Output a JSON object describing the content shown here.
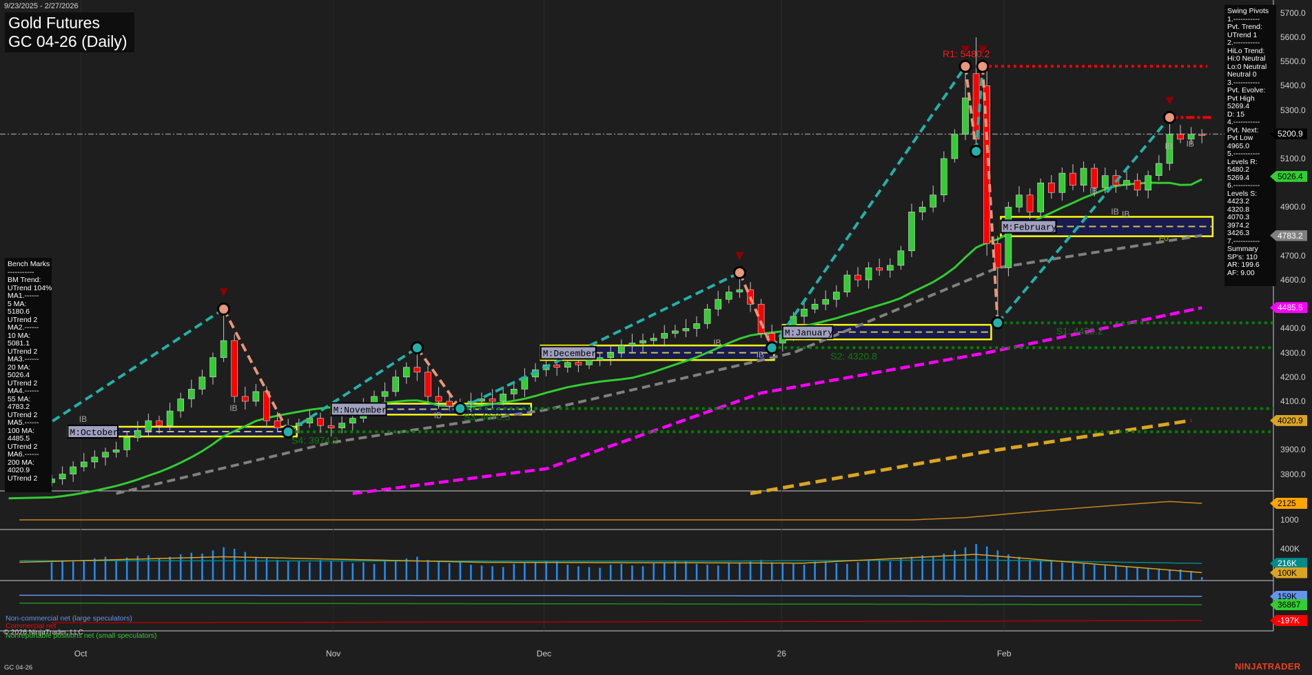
{
  "header": {
    "date_range": "9/23/2025 - 2/27/2026",
    "title_line1": "Gold Futures",
    "title_line2": "GC 04-26 (Daily)"
  },
  "bench_marks": [
    "Bench Marks",
    "-----------",
    "BM Trend:",
    "UTrend 104%",
    "MA1.------",
    "5 MA:",
    "5180.6",
    "UTrend 2",
    "MA2.------",
    "10 MA:",
    "5081.1",
    "UTrend 2",
    "MA3.------",
    "20 MA:",
    "5026.4",
    "UTrend 2",
    "MA4.------",
    "55 MA:",
    "4783.2",
    "UTrend 2",
    "MA5.------",
    "100 MA:",
    "4485.5",
    "UTrend 2",
    "MA6.------",
    "200 MA:",
    "4020.9",
    "UTrend 2"
  ],
  "swing_pivots": [
    "Swing Pivots",
    "1.-----------",
    "Pvt. Trend:",
    "UTrend 1",
    "2.-----------",
    "HiLo Trend:",
    "Hi:0 Neutral",
    "Lo:0 Neutral",
    "Neutral 0",
    "3.-----------",
    "Pvt. Evolve:",
    "Pvt High",
    "5269.4",
    "D: 15",
    "4.-----------",
    "Pvt. Next:",
    "Pvt Low",
    "4965.0",
    "5.-----------",
    "Levels R:",
    "5480.2",
    "5269.4",
    "6.-----------",
    "Levels S:",
    "4423.2",
    "4320.8",
    "4070.3",
    "3974.2",
    "3426.3",
    "7.-----------",
    "Summary",
    "SP's: 110",
    "AR: 199.6",
    "AF: 9.00"
  ],
  "price_axis": [
    "5700.0",
    "5600.0",
    "5500.0",
    "5400.0",
    "5300.0",
    "5100.0",
    "4900.0",
    "4700.0",
    "4600.0",
    "4400.0",
    "4300.0",
    "4200.0",
    "4100.0",
    "3900.0",
    "3800.0"
  ],
  "price_axis_values": [
    5700,
    5600,
    5500,
    5400,
    5300,
    5100,
    4900,
    4700,
    4600,
    4400,
    4300,
    4200,
    4100,
    3900,
    3800
  ],
  "tags": [
    {
      "label": "5200.9",
      "value": 5200.9,
      "panel": "price",
      "bg": "#000000",
      "fg": "#ffffff"
    },
    {
      "label": "5026.4",
      "value": 5026.4,
      "panel": "price",
      "bg": "#32cd32",
      "fg": "#000000"
    },
    {
      "label": "4783.2",
      "value": 4783.2,
      "panel": "price",
      "bg": "#808080",
      "fg": "#ffffff"
    },
    {
      "label": "4485.5",
      "value": 4485.5,
      "panel": "price",
      "bg": "#ff00ff",
      "fg": "#ffffff"
    },
    {
      "label": "4020.9",
      "value": 4020.9,
      "panel": "price",
      "bg": "#daa520",
      "fg": "#000000"
    },
    {
      "label": "2125",
      "value": 2125,
      "panel": "p2",
      "bg": "#ffa500",
      "fg": "#000000"
    },
    {
      "label": "216K",
      "value": 216,
      "panel": "vol",
      "bg": "#008b8b",
      "fg": "#ffffff"
    },
    {
      "label": "100K",
      "value": 100,
      "panel": "vol",
      "bg": "#daa520",
      "fg": "#000000"
    },
    {
      "label": "159K",
      "value": 159,
      "panel": "cot",
      "bg": "#6495ed",
      "fg": "#000000"
    },
    {
      "label": "36867",
      "value": 36.867,
      "panel": "cot",
      "bg": "#32cd32",
      "fg": "#000000"
    },
    {
      "label": "-197K",
      "value": -197,
      "panel": "cot",
      "bg": "#ff0000",
      "fg": "#ffffff"
    }
  ],
  "sub_axis": {
    "p2_tick": "1000",
    "p2_tick_value": 1000,
    "vol_tick": "400K",
    "vol_tick_value": 400
  },
  "x_axis": [
    {
      "label": "Oct",
      "index": 2.7
    },
    {
      "label": "Nov",
      "index": 26.2
    },
    {
      "label": "Dec",
      "index": 45.8
    },
    {
      "label": "26",
      "index": 67.9
    },
    {
      "label": "Feb",
      "index": 88.6
    }
  ],
  "legend": {
    "noncommercial": "Non-commercial net (large speculators)",
    "commercial": "Commercial net",
    "nonreportable": "Nonreportable positions net (small speculators)",
    "copyright": "© 2026 NinjaTrader, LLC"
  },
  "footer": {
    "instrument": "GC 04-26",
    "brand": "NINJATRADER"
  },
  "colors": {
    "up": "#32cd32",
    "down": "#ff0000",
    "ma20": "#32cd32",
    "ma55": "#808080",
    "ma100": "#ff00ff",
    "ma200": "#daa520",
    "swing_up": "#20b2aa",
    "swing_down": "#e9967a",
    "support": "#008000",
    "resistance": "#ff0000",
    "box_fill": "#191a4f",
    "box_border": "#ffff00"
  },
  "chart_data": {
    "type": "candlestick",
    "title": "Gold Futures GC 04-26 (Daily)",
    "ylim": [
      3750,
      5720
    ],
    "closes": [
      3780,
      3800,
      3830,
      3850,
      3870,
      3890,
      3900,
      3950,
      3980,
      4020,
      4000,
      4060,
      4110,
      4150,
      4200,
      4280,
      4350,
      4120,
      4100,
      4140,
      4020,
      3990,
      4000,
      4010,
      4030,
      4000,
      3990,
      4010,
      4030,
      4080,
      4120,
      4140,
      4200,
      4240,
      4220,
      4120,
      4100,
      4080,
      4090,
      4100,
      4110,
      4100,
      4130,
      4150,
      4200,
      4230,
      4250,
      4240,
      4260,
      4250,
      4270,
      4280,
      4300,
      4330,
      4340,
      4350,
      4360,
      4380,
      4390,
      4400,
      4420,
      4480,
      4520,
      4550,
      4560,
      4500,
      4380,
      4340,
      4370,
      4450,
      4480,
      4500,
      4520,
      4550,
      4620,
      4600,
      4650,
      4640,
      4660,
      4720,
      4880,
      4900,
      4950,
      5100,
      5200,
      5350,
      5180,
      4750,
      4650,
      4900,
      4950,
      4880,
      5000,
      4960,
      5040,
      4990,
      5060,
      4980,
      5030,
      4990,
      5010,
      4970,
      5030,
      5080,
      5200,
      5180,
      5200,
      5195
    ],
    "overrides": {
      "16": {
        "h": 4480
      },
      "22": {
        "l": 3974
      },
      "34": {
        "h": 4320
      },
      "38": {
        "l": 4070
      },
      "64": {
        "h": 4630
      },
      "67": {
        "l": 4320
      },
      "85": {
        "h": 5480,
        "o": 5200
      },
      "86": {
        "o": 5450,
        "h": 5600,
        "l": 5130
      },
      "87": {
        "o": 5400,
        "h": 5480,
        "l": 4700
      },
      "88": {
        "l": 4423
      },
      "104": {
        "h": 5269
      }
    },
    "volume_k": [
      230,
      250,
      240,
      260,
      280,
      300,
      270,
      290,
      310,
      320,
      280,
      300,
      330,
      350,
      340,
      380,
      420,
      400,
      360,
      300,
      280,
      260,
      250,
      240,
      230,
      260,
      250,
      240,
      220,
      230,
      210,
      250,
      260,
      280,
      300,
      260,
      240,
      220,
      230,
      200,
      190,
      180,
      170,
      210,
      220,
      230,
      240,
      250,
      200,
      180,
      170,
      160,
      200,
      210,
      190,
      180,
      220,
      230,
      240,
      250,
      210,
      200,
      190,
      220,
      230,
      240,
      260,
      230,
      220,
      210,
      200,
      240,
      230,
      220,
      210,
      230,
      250,
      260,
      240,
      280,
      300,
      320,
      300,
      340,
      380,
      420,
      460,
      430,
      380,
      330,
      300,
      260,
      250,
      240,
      230,
      220,
      210,
      200,
      190,
      180,
      170,
      160,
      160,
      150,
      140,
      140,
      120,
      44
    ],
    "ma55": [
      [
        6,
        3720
      ],
      [
        26,
        3930
      ],
      [
        46,
        4065
      ],
      [
        69,
        4300
      ],
      [
        88,
        4650
      ],
      [
        107,
        4783.2
      ]
    ],
    "ma100": [
      [
        28,
        3720
      ],
      [
        46,
        3822
      ],
      [
        66,
        4134
      ],
      [
        87,
        4300
      ],
      [
        107,
        4485.5
      ]
    ],
    "ma200": [
      [
        65,
        3720
      ],
      [
        87,
        3893
      ],
      [
        106,
        4020.9
      ]
    ],
    "swing_points": [
      [
        -4,
        3900
      ],
      [
        16,
        4480
      ],
      [
        22,
        3974
      ],
      [
        34,
        4320
      ],
      [
        38,
        4070
      ],
      [
        64,
        4630
      ],
      [
        67,
        4320
      ],
      [
        85,
        5480
      ],
      [
        86,
        5130
      ],
      [
        86.6,
        5480
      ],
      [
        88,
        4423
      ],
      [
        104,
        5269.4
      ]
    ],
    "levels": [
      {
        "label": "R1: 5480.2",
        "value": 5480.2,
        "from": 86.6,
        "to": 107.5,
        "kind": "resistance",
        "style": "dot"
      },
      {
        "label": "",
        "value": 5269.4,
        "from": 104,
        "to": 108,
        "kind": "resistance",
        "style": "dashdot"
      },
      {
        "label": "S1: 4423.2",
        "value": 4423.2,
        "from": 88,
        "to": 115,
        "kind": "support",
        "style": "dot"
      },
      {
        "label": "S2: 4320.8",
        "value": 4320.8,
        "from": 67,
        "to": 115,
        "kind": "support",
        "style": "dot"
      },
      {
        "label": "S3: 4070.3",
        "value": 4070.3,
        "from": 38,
        "to": 115,
        "kind": "support",
        "style": "dot"
      },
      {
        "label": "S4: 3974.2",
        "value": 3974.2,
        "from": 22,
        "to": 115,
        "kind": "support",
        "style": "dot"
      }
    ],
    "last_price": 5200.9,
    "monthly_boxes": [
      {
        "label": "M:October",
        "lo": 3955,
        "hi": 3995,
        "from": 1.5,
        "to": 22.8
      },
      {
        "label": "M:November",
        "lo": 4045,
        "hi": 4090,
        "from": 26,
        "to": 44.6
      },
      {
        "label": "M:December",
        "lo": 4270,
        "hi": 4330,
        "from": 45.5,
        "to": 67.2
      },
      {
        "label": "M:January",
        "lo": 4355,
        "hi": 4415,
        "from": 68,
        "to": 87.4
      },
      {
        "label": "M:February",
        "lo": 4780,
        "hi": 4860,
        "from": 88.3,
        "to": 108
      }
    ],
    "f0_label": "F0",
    "ib_label": "IB",
    "ib_marks": [
      [
        3,
        4015
      ],
      [
        17,
        4060
      ],
      [
        36,
        4030
      ],
      [
        62,
        4330
      ],
      [
        66,
        4280
      ],
      [
        70,
        4355
      ],
      [
        97,
        4955
      ],
      [
        99,
        4870
      ],
      [
        100,
        4860
      ],
      [
        104,
        5140
      ],
      [
        106,
        5150
      ]
    ],
    "p2_line": [
      [
        -3,
        1000
      ],
      [
        80,
        1000
      ],
      [
        85,
        1150
      ],
      [
        92,
        1600
      ],
      [
        100,
        2050
      ],
      [
        104,
        2250
      ],
      [
        107,
        2125
      ]
    ],
    "vol_teal": [
      [
        -3,
        250
      ],
      [
        60,
        245
      ],
      [
        86,
        260
      ],
      [
        107,
        216
      ]
    ],
    "vol_orange": [
      [
        -3,
        230
      ],
      [
        16,
        300
      ],
      [
        40,
        230
      ],
      [
        70,
        220
      ],
      [
        86,
        330
      ],
      [
        95,
        230
      ],
      [
        107,
        100
      ]
    ],
    "cot_noncommercial_k": [
      [
        -3,
        175
      ],
      [
        40,
        172
      ],
      [
        107,
        159
      ]
    ],
    "cot_nonreportable_k": [
      [
        -3,
        60
      ],
      [
        107,
        36.867
      ]
    ],
    "cot_commercial_k": [
      [
        0,
        -230
      ],
      [
        60,
        -215
      ],
      [
        107,
        -197
      ]
    ]
  }
}
